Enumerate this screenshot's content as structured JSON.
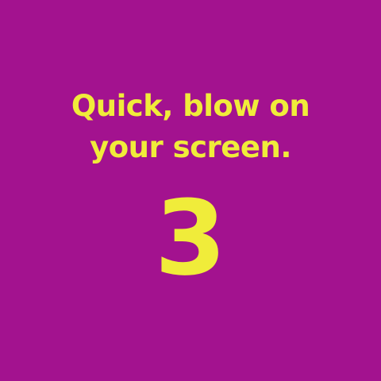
{
  "message": {
    "line1": "Quick, blow on",
    "line2": "your screen."
  },
  "countdown": {
    "value": "3"
  },
  "colors": {
    "background": "#a3128f",
    "text": "#f0ec3a"
  }
}
